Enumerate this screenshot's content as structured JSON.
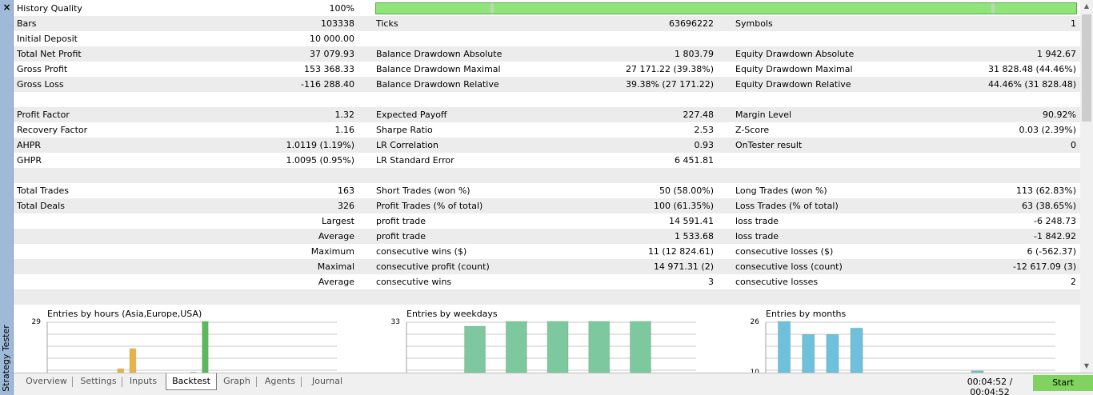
{
  "window": {
    "title": "Strategy Tester",
    "close_glyph": "×"
  },
  "history_quality": {
    "label": "History Quality",
    "value": "100%",
    "progress_fraction": 1.0
  },
  "stats_rows": [
    {
      "shade": true,
      "cells": [
        "Bars",
        "103338",
        "Ticks",
        "63696222",
        "Symbols",
        "1"
      ]
    },
    {
      "shade": false,
      "cells": [
        "Initial Deposit",
        "10 000.00",
        "",
        "",
        "",
        ""
      ]
    },
    {
      "shade": true,
      "cells": [
        "Total Net Profit",
        "37 079.93",
        "Balance Drawdown Absolute",
        "1 803.79",
        "Equity Drawdown Absolute",
        "1 942.67"
      ]
    },
    {
      "shade": false,
      "cells": [
        "Gross Profit",
        "153 368.33",
        "Balance Drawdown Maximal",
        "27 171.22 (39.38%)",
        "Equity Drawdown Maximal",
        "31 828.48 (44.46%)"
      ]
    },
    {
      "shade": true,
      "cells": [
        "Gross Loss",
        "-116 288.40",
        "Balance Drawdown Relative",
        "39.38% (27 171.22)",
        "Equity Drawdown Relative",
        "44.46% (31 828.48)"
      ]
    },
    {
      "shade": false,
      "cells": [
        "",
        "",
        "",
        "",
        "",
        ""
      ]
    },
    {
      "shade": true,
      "cells": [
        "Profit Factor",
        "1.32",
        "Expected Payoff",
        "227.48",
        "Margin Level",
        "90.92%"
      ]
    },
    {
      "shade": false,
      "cells": [
        "Recovery Factor",
        "1.16",
        "Sharpe Ratio",
        "2.53",
        "Z-Score",
        "0.03 (2.39%)"
      ]
    },
    {
      "shade": true,
      "cells": [
        "AHPR",
        "1.0119 (1.19%)",
        "LR Correlation",
        "0.93",
        "OnTester result",
        "0"
      ]
    },
    {
      "shade": false,
      "cells": [
        "GHPR",
        "1.0095 (0.95%)",
        "LR Standard Error",
        "6 451.81",
        "",
        ""
      ]
    },
    {
      "shade": true,
      "cells": [
        "",
        "",
        "",
        "",
        "",
        ""
      ]
    },
    {
      "shade": false,
      "cells": [
        "Total Trades",
        "163",
        "Short Trades (won %)",
        "50 (58.00%)",
        "Long Trades (won %)",
        "113 (62.83%)"
      ]
    },
    {
      "shade": true,
      "cells": [
        "Total Deals",
        "326",
        "Profit Trades (% of total)",
        "100 (61.35%)",
        "Loss Trades (% of total)",
        "63 (38.65%)"
      ]
    }
  ],
  "trade_rows": [
    {
      "shade": false,
      "rowlabel": "Largest",
      "cells": [
        "profit trade",
        "14 591.41",
        "loss trade",
        "-6 248.73"
      ]
    },
    {
      "shade": true,
      "rowlabel": "Average",
      "cells": [
        "profit trade",
        "1 533.68",
        "loss trade",
        "-1 842.92"
      ]
    },
    {
      "shade": false,
      "rowlabel": "Maximum",
      "cells": [
        "consecutive wins ($)",
        "11 (12 824.61)",
        "consecutive losses ($)",
        "6 (-562.37)"
      ]
    },
    {
      "shade": true,
      "rowlabel": "Maximal",
      "cells": [
        "consecutive profit (count)",
        "14 971.31 (2)",
        "consecutive loss (count)",
        "-12 617.09 (3)"
      ]
    },
    {
      "shade": false,
      "rowlabel": "Average",
      "cells": [
        "consecutive wins",
        "3",
        "consecutive losses",
        "2"
      ]
    },
    {
      "shade": true,
      "rowlabel": "",
      "cells": [
        "",
        "",
        "",
        ""
      ]
    }
  ],
  "chart_data": [
    {
      "type": "bar",
      "title": "Entries by hours (Asia,Europe,USA)",
      "y_tick_labels": [
        "29"
      ],
      "ylim": [
        0,
        29
      ],
      "grid": true,
      "series": [
        {
          "color": "#f0b040",
          "bars": [
            {
              "x": 4,
              "value": 3
            },
            {
              "x": 5,
              "value": 14
            }
          ]
        },
        {
          "color": "#5cb85c",
          "bars": [
            {
              "x": 10,
              "value": 1
            },
            {
              "x": 11,
              "value": 29
            }
          ]
        }
      ],
      "x_slots": 24
    },
    {
      "type": "bar",
      "title": "Entries by weekdays",
      "y_tick_labels": [
        "33"
      ],
      "ylim": [
        0,
        33
      ],
      "grid": true,
      "series": [
        {
          "color": "#7ec8a0",
          "bars": [
            {
              "x": 1,
              "value": 30
            },
            {
              "x": 2,
              "value": 33
            },
            {
              "x": 3,
              "value": 33
            },
            {
              "x": 4,
              "value": 33
            },
            {
              "x": 5,
              "value": 33
            }
          ]
        }
      ],
      "x_slots": 7
    },
    {
      "type": "bar",
      "title": "Entries by months",
      "y_tick_labels": [
        "26",
        "10"
      ],
      "ylim": [
        10,
        26
      ],
      "grid": true,
      "series": [
        {
          "color": "#6ec0dc",
          "bars": [
            {
              "x": 0,
              "value": 26
            },
            {
              "x": 1,
              "value": 22
            },
            {
              "x": 2,
              "value": 22
            },
            {
              "x": 3,
              "value": 24
            },
            {
              "x": 8,
              "value": 11
            }
          ]
        }
      ],
      "x_slots": 12
    }
  ],
  "tabs": [
    {
      "label": "Overview",
      "active": false
    },
    {
      "label": "Settings",
      "active": false
    },
    {
      "label": "Inputs",
      "active": false
    },
    {
      "label": "Backtest",
      "active": true
    },
    {
      "label": "Graph",
      "active": false
    },
    {
      "label": "Agents",
      "active": false
    },
    {
      "label": "Journal",
      "active": false
    }
  ],
  "timer": "00:04:52 / 00:04:52",
  "start_button": "Start",
  "colors": {
    "accent_green": "#7fd35e",
    "sidebar_blue": "#9fb9d9",
    "row_shade": "#ececec"
  }
}
